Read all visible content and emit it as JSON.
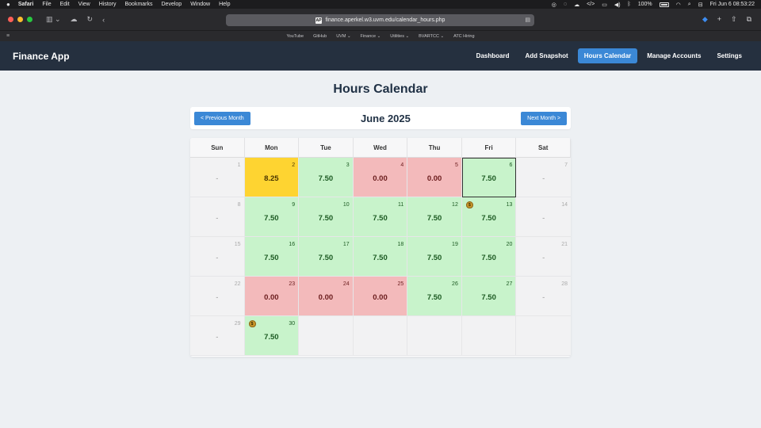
{
  "menubar": {
    "app": "Safari",
    "items": [
      "File",
      "Edit",
      "View",
      "History",
      "Bookmarks",
      "Develop",
      "Window",
      "Help"
    ],
    "battery": "100%",
    "datetime": "Fri Jun 6  08:53:22"
  },
  "browser": {
    "url": "finance.aperkel.w3.uvm.edu/calendar_hours.php",
    "favicon": "AP",
    "bookmarks": [
      "YouTube",
      "GitHub",
      "UVM ⌄",
      "Finance ⌄",
      "Utilities ⌄",
      "BVARTCC ⌄",
      "ATC Hiring"
    ]
  },
  "navbar": {
    "brand": "Finance App",
    "links": [
      "Dashboard",
      "Add Snapshot",
      "Hours Calendar",
      "Manage Accounts",
      "Settings"
    ],
    "active": "Hours Calendar"
  },
  "page": {
    "title": "Hours Calendar",
    "prev_label": "< Previous Month",
    "next_label": "Next Month >",
    "month_label": "June 2025"
  },
  "calendar": {
    "weekdays": [
      "Sun",
      "Mon",
      "Tue",
      "Wed",
      "Thu",
      "Fri",
      "Sat"
    ],
    "weeks": [
      [
        {
          "day": "1",
          "hours": "-",
          "status": "weekend"
        },
        {
          "day": "2",
          "hours": "8.25",
          "status": "yellow"
        },
        {
          "day": "3",
          "hours": "7.50",
          "status": "green"
        },
        {
          "day": "4",
          "hours": "0.00",
          "status": "red"
        },
        {
          "day": "5",
          "hours": "0.00",
          "status": "red"
        },
        {
          "day": "6",
          "hours": "7.50",
          "status": "green",
          "today": true
        },
        {
          "day": "7",
          "hours": "-",
          "status": "weekend"
        }
      ],
      [
        {
          "day": "8",
          "hours": "-",
          "status": "weekend"
        },
        {
          "day": "9",
          "hours": "7.50",
          "status": "green"
        },
        {
          "day": "10",
          "hours": "7.50",
          "status": "green"
        },
        {
          "day": "11",
          "hours": "7.50",
          "status": "green"
        },
        {
          "day": "12",
          "hours": "7.50",
          "status": "green"
        },
        {
          "day": "13",
          "hours": "7.50",
          "status": "green",
          "payday": true
        },
        {
          "day": "14",
          "hours": "-",
          "status": "weekend"
        }
      ],
      [
        {
          "day": "15",
          "hours": "-",
          "status": "weekend"
        },
        {
          "day": "16",
          "hours": "7.50",
          "status": "green"
        },
        {
          "day": "17",
          "hours": "7.50",
          "status": "green"
        },
        {
          "day": "18",
          "hours": "7.50",
          "status": "green"
        },
        {
          "day": "19",
          "hours": "7.50",
          "status": "green"
        },
        {
          "day": "20",
          "hours": "7.50",
          "status": "green"
        },
        {
          "day": "21",
          "hours": "-",
          "status": "weekend"
        }
      ],
      [
        {
          "day": "22",
          "hours": "-",
          "status": "weekend"
        },
        {
          "day": "23",
          "hours": "0.00",
          "status": "red"
        },
        {
          "day": "24",
          "hours": "0.00",
          "status": "red"
        },
        {
          "day": "25",
          "hours": "0.00",
          "status": "red"
        },
        {
          "day": "26",
          "hours": "7.50",
          "status": "green"
        },
        {
          "day": "27",
          "hours": "7.50",
          "status": "green"
        },
        {
          "day": "28",
          "hours": "-",
          "status": "weekend"
        }
      ],
      [
        {
          "day": "29",
          "hours": "-",
          "status": "weekend"
        },
        {
          "day": "30",
          "hours": "7.50",
          "status": "green",
          "payday": true
        },
        {
          "day": "",
          "hours": "",
          "status": "empty"
        },
        {
          "day": "",
          "hours": "",
          "status": "empty"
        },
        {
          "day": "",
          "hours": "",
          "status": "empty"
        },
        {
          "day": "",
          "hours": "",
          "status": "empty"
        },
        {
          "day": "",
          "hours": "",
          "status": "empty"
        }
      ]
    ],
    "colors": {
      "green": "#c8f3cb",
      "red": "#f3babb",
      "yellow": "#fed431",
      "weekend": "#f2f2f3"
    },
    "payday_icon": "money-bag-icon"
  }
}
